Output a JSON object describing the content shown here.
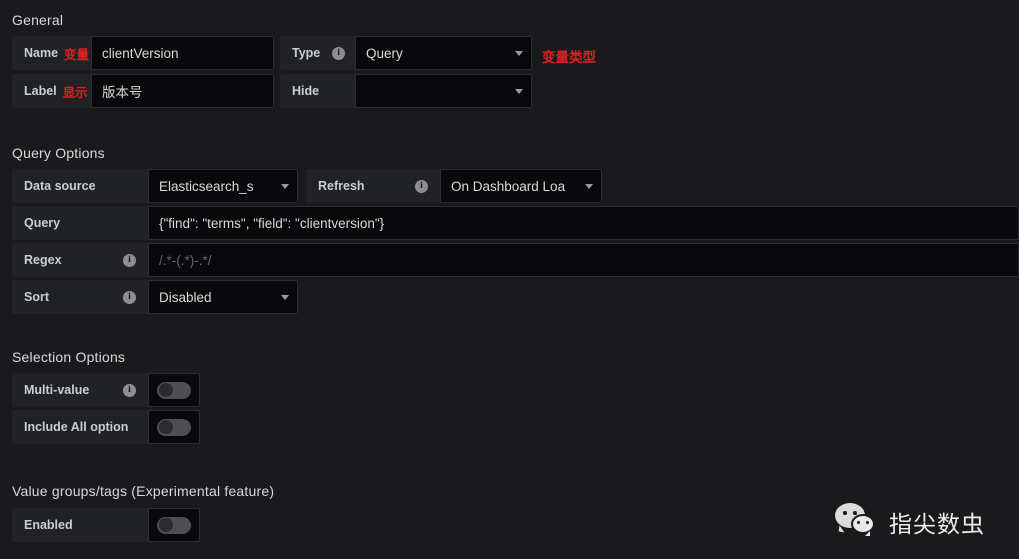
{
  "sections": {
    "general": {
      "title": "General"
    },
    "query_options": {
      "title": "Query Options"
    },
    "selection_options": {
      "title": "Selection Options"
    },
    "value_groups": {
      "title": "Value groups/tags (Experimental feature)"
    }
  },
  "general": {
    "name_label": "Name",
    "name_annotation": "变量",
    "name_value": "clientVersion",
    "label_label": "Label",
    "label_annotation": "显示",
    "label_value": "版本号",
    "type_label": "Type",
    "type_value": "Query",
    "type_annotation": "变量类型",
    "hide_label": "Hide",
    "hide_value": ""
  },
  "query_options": {
    "data_source_label": "Data source",
    "data_source_value": "Elasticsearch_s",
    "refresh_label": "Refresh",
    "refresh_value": "On Dashboard Loa",
    "query_label": "Query",
    "query_value": "{\"find\": \"terms\", \"field\": \"clientversion\"}",
    "regex_label": "Regex",
    "regex_placeholder": "/.*-(.*)-.*/",
    "regex_value": "",
    "sort_label": "Sort",
    "sort_value": "Disabled"
  },
  "selection_options": {
    "multi_value_label": "Multi-value",
    "multi_value_state": "off",
    "include_all_label": "Include All option",
    "include_all_state": "off"
  },
  "value_groups": {
    "enabled_label": "Enabled",
    "enabled_state": "off"
  },
  "watermark": {
    "text": "指尖数虫",
    "icon": "wechat-icon"
  },
  "colors": {
    "background": "#1a1a1d",
    "label_cell": "#202226",
    "field": "#09090b",
    "text": "#d8d9da",
    "annotation_red": "#e02020",
    "toggle_track": "#4d4f54"
  }
}
